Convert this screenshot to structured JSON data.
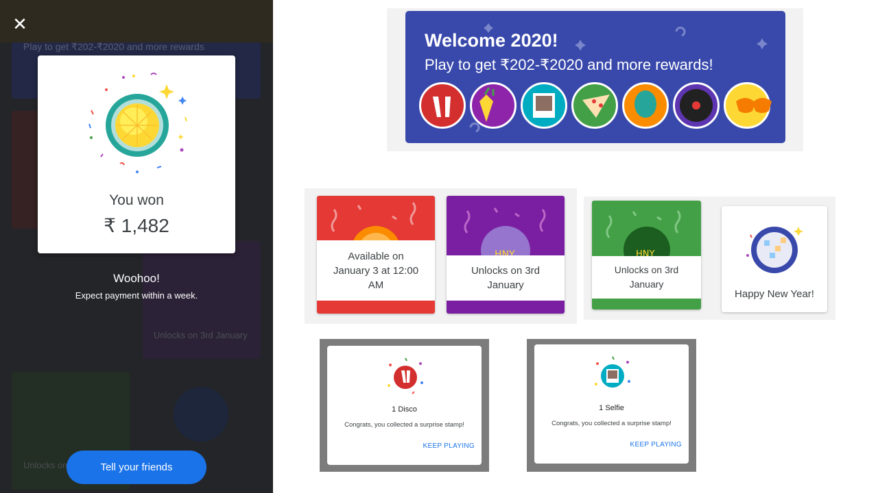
{
  "left_panel": {
    "bg_header_text": "Play to get ₹202-₹2020 and more rewards",
    "bg_tile_text_1": "Unlocks on 3rd January",
    "bg_tile_text_2": "Unlocks on 3rd January",
    "won_title": "You won",
    "won_amount": "₹ 1,482",
    "woohoo": "Woohoo!",
    "expect": "Expect payment within a week.",
    "tell_friends": "Tell your friends"
  },
  "banner": {
    "title": "Welcome 2020!",
    "subtitle": "Play to get ₹202-₹2020 and more rewards!",
    "stamps": [
      {
        "name": "disco-shoes",
        "color": "#d32f2f"
      },
      {
        "name": "pineapple",
        "color": "#8e24aa"
      },
      {
        "name": "selfie",
        "color": "#00acc1"
      },
      {
        "name": "pizza",
        "color": "#43a047"
      },
      {
        "name": "balloon",
        "color": "#fb8c00"
      },
      {
        "name": "vinyl",
        "color": "#5e35b1"
      },
      {
        "name": "party-glasses",
        "color": "#fdd835"
      }
    ]
  },
  "tiles": [
    {
      "text": "Available on January 3 at 12:00 AM",
      "color": "#e53935"
    },
    {
      "text": "Unlocks on 3rd January",
      "color": "#7b1fa2"
    },
    {
      "text": "Unlocks on 3rd January",
      "color": "#43a047"
    }
  ],
  "hny_label": "Happy New Year!",
  "dialogs": [
    {
      "name": "1 Disco",
      "congrats": "Congrats, you collected a surprise stamp!",
      "action": "KEEP PLAYING"
    },
    {
      "name": "1 Selfie",
      "congrats": "Congrats, you collected a surprise stamp!",
      "action": "KEEP PLAYING"
    }
  ]
}
